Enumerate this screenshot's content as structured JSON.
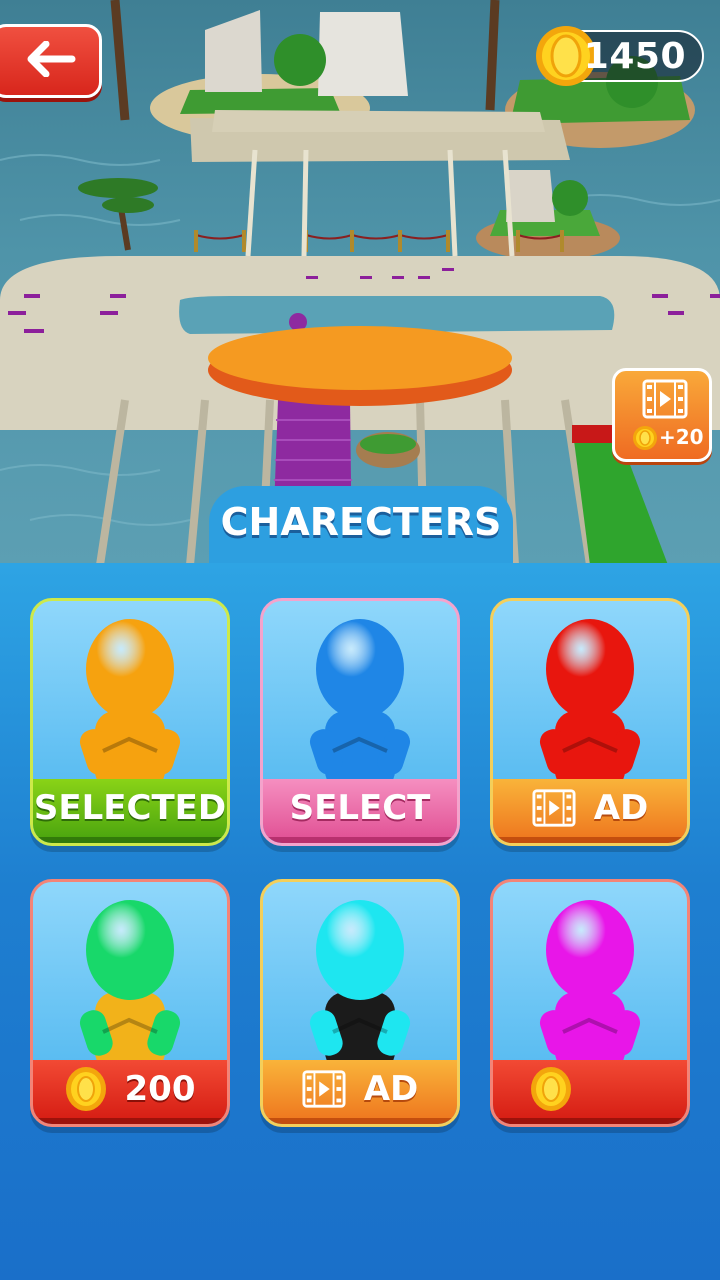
{
  "header": {
    "back_icon": "arrow-left-icon",
    "coin_icon": "coin-icon",
    "coins": "1450"
  },
  "reward": {
    "icon": "film-play-icon",
    "amount": "+20"
  },
  "panel": {
    "title": "CHARECTERS"
  },
  "characters": [
    {
      "color": "#f6a20f",
      "status": "SELECTED",
      "icon": null
    },
    {
      "color": "#1f86e6",
      "status": "SELECT",
      "icon": null
    },
    {
      "color": "#e8160e",
      "status": "AD",
      "icon": "film-play-icon"
    },
    {
      "color": "#18d86a",
      "shirt": "#f2b21a",
      "status": "200",
      "icon": "coin-icon"
    },
    {
      "color": "#1ee6f0",
      "shirt": "#1b1b1b",
      "status": "AD",
      "icon": "film-play-icon"
    },
    {
      "color": "#e816e8",
      "status": "",
      "icon": "coin-icon"
    }
  ]
}
